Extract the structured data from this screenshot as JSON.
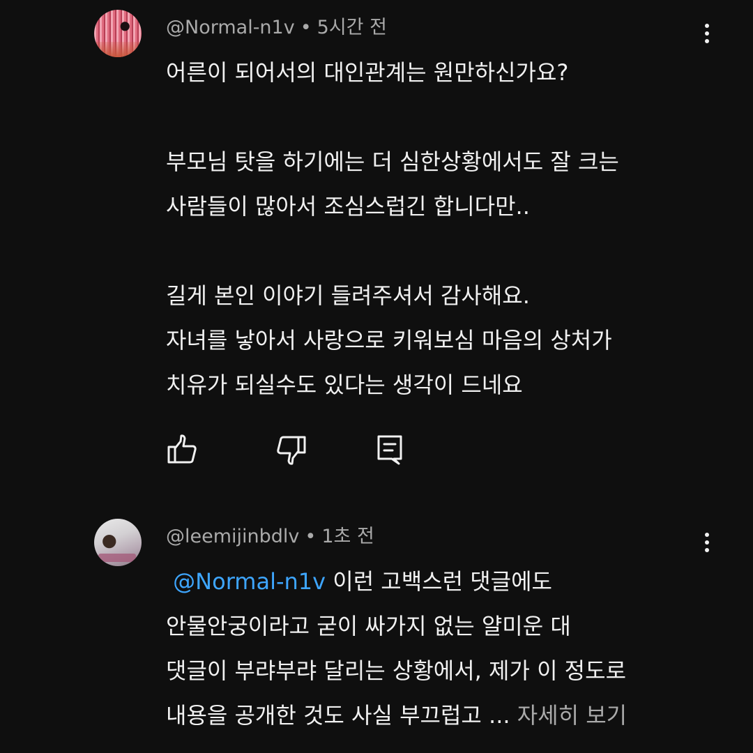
{
  "comments": [
    {
      "username": "@Normal-n1v",
      "separator": "•",
      "time": "5시간 전",
      "lines": [
        "어른이 되어서의 대인관계는 원만하신가요?",
        "",
        "부모님 탓을 하기에는 더 심한상황에서도 잘 크는",
        "사람들이 많아서 조심스럽긴 합니다만..",
        "",
        "길게 본인 이야기 들려주셔서 감사해요.",
        "자녀를 낳아서 사랑으로 키워보심 마음의 상처가",
        "치유가 되실수도 있다는 생각이 드네요"
      ]
    },
    {
      "username": "@leemijinbdlv",
      "separator": "•",
      "time": "1초 전",
      "mention": "@Normal-n1v",
      "first_line_rest": " 이런 고백스런 댓글에도",
      "lines": [
        "안물안궁이라고 굳이 싸가지 없는 얄미운 대",
        "댓글이 부랴부랴 달리는 상황에서, 제가 이 정도로",
        "내용을 공개한 것도 사실 부끄럽고 ... "
      ],
      "read_more": "자세히 보기"
    }
  ],
  "icons": {
    "like": "thumbs-up-icon",
    "dislike": "thumbs-down-icon",
    "reply": "reply-comment-icon",
    "more": "more-vert-icon"
  },
  "colors": {
    "background": "#0f0f0f",
    "text": "#f1f1f1",
    "secondary": "#aaaaaa",
    "mention": "#3ea6ff"
  }
}
